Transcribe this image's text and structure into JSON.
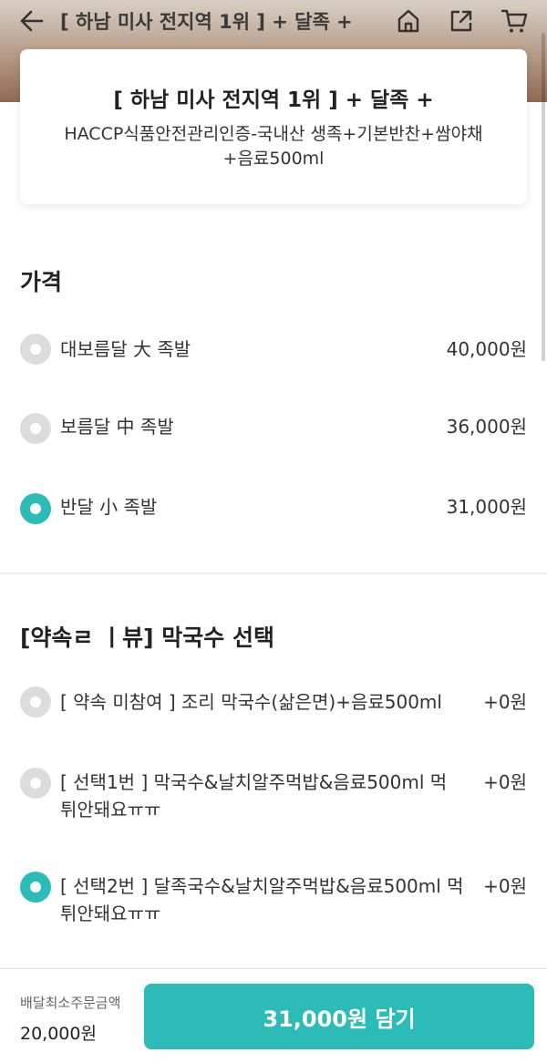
{
  "header": {
    "title": "[ 하남 미사 전지역 1위 ] + 달족 +",
    "icons": [
      "back-arrow-icon",
      "home-icon",
      "share-icon",
      "cart-icon"
    ]
  },
  "menu": {
    "name": "[ 하남 미사 전지역 1위 ] + 달족 +",
    "description": "HACCP식품안전관리인증-국내산 생족+기본반찬+쌈야채+음료500ml"
  },
  "price_section": {
    "title": "가격",
    "options": [
      {
        "label": "대보름달 大 족발",
        "price": "40,000원",
        "selected": false
      },
      {
        "label": "보름달 中 족발",
        "price": "36,000원",
        "selected": false
      },
      {
        "label": "반달 小 족발",
        "price": "31,000원",
        "selected": true
      }
    ]
  },
  "noodle_section": {
    "title": "[약속ㄹ  ㅣ뷰] 막국수 선택",
    "options": [
      {
        "label": "[ 약속 미참여 ] 조리 막국수(삶은면)+음료500ml",
        "price": "+0원",
        "selected": false
      },
      {
        "label": "[ 선택1번 ] 막국수&날치알주먹밥&음료500ml 먹튀안돼요ㅠㅠ",
        "price": "+0원",
        "selected": false
      },
      {
        "label": "[ 선택2번 ] 달족국수&날치알주먹밥&음료500ml 먹튀안돼요ㅠㅠ",
        "price": "+0원",
        "selected": true
      }
    ]
  },
  "footer": {
    "min_order_label": "배달최소주문금액",
    "min_order_value": "20,000원",
    "add_button": "31,000원 담기"
  },
  "colors": {
    "accent": "#2cbcb7",
    "radio_off": "#dcdcdc"
  }
}
